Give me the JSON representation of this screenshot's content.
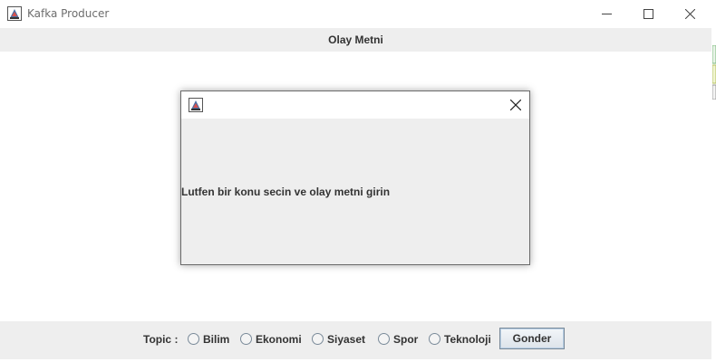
{
  "window": {
    "title": "Kafka Producer",
    "header": "Olay Metni"
  },
  "bottom_bar": {
    "topic_label": "Topic :",
    "topics": [
      "Bilim",
      "Ekonomi",
      "Siyaset",
      "Spor",
      "Teknoloji"
    ],
    "send_label": "Gonder"
  },
  "dialog": {
    "message": "Lutfen bir konu secin ve olay metni girin"
  },
  "icons": {
    "app": "java-app-icon",
    "minimize": "minimize-icon",
    "maximize": "maximize-icon",
    "close": "close-icon"
  }
}
